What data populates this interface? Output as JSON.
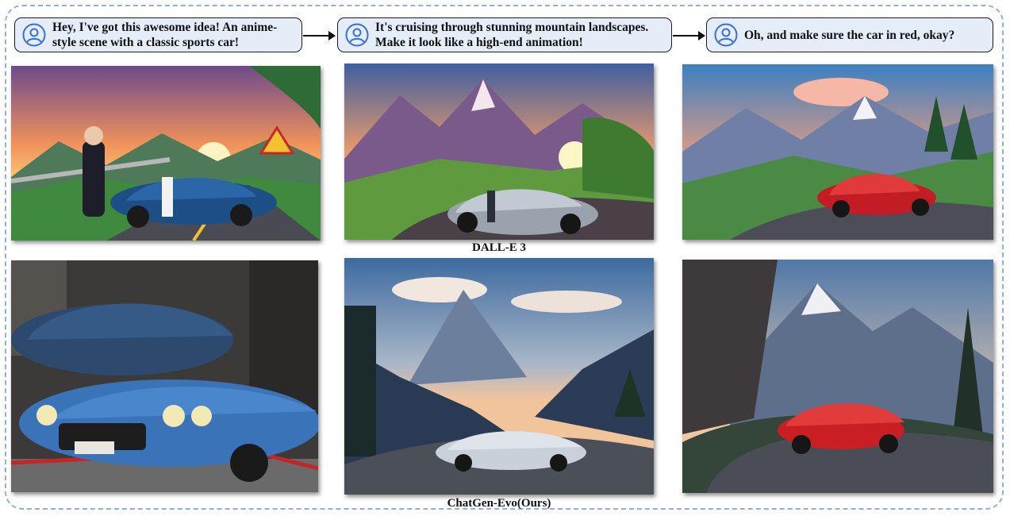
{
  "dialogue": [
    {
      "line1": "Hey, I've got this awesome idea! An anime-",
      "line2": "style scene with a classic sports car!"
    },
    {
      "line1": "It's cruising through stunning mountain landscapes.",
      "line2": "Make it look like a high-end animation!"
    },
    {
      "line1": "Oh, and make sure the car in red, okay?",
      "line2": ""
    }
  ],
  "captions": {
    "row1": "DALL-E 3",
    "row2": "ChatGen-Evo(Ours)"
  },
  "icons": {
    "speaker": "user-avatar-icon",
    "flow": "right-arrow-icon"
  },
  "colors": {
    "frame": "#8fb2dd",
    "bubble": "#e5edf8",
    "avatar": "#3a6fd8"
  }
}
